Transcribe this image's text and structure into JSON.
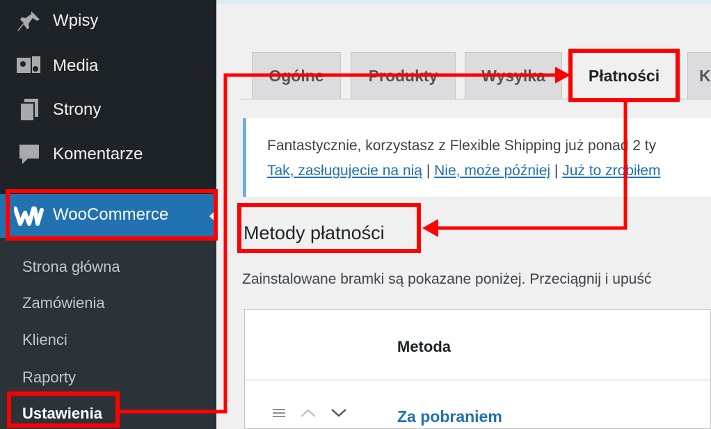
{
  "sidebar": {
    "items": [
      {
        "label": "Wpisy",
        "icon": "pin-icon"
      },
      {
        "label": "Media",
        "icon": "media-icon"
      },
      {
        "label": "Strony",
        "icon": "pages-icon"
      },
      {
        "label": "Komentarze",
        "icon": "comments-icon"
      }
    ],
    "woocommerce": {
      "label": "WooCommerce",
      "icon": "woocommerce-icon"
    },
    "submenu": [
      "Strona główna",
      "Zamówienia",
      "Klienci",
      "Raporty",
      "Ustawienia"
    ]
  },
  "tabs": [
    "Ogólne",
    "Produkty",
    "Wysyłka",
    "Płatności",
    "K"
  ],
  "notice": {
    "text": "Fantastycznie, korzystasz z Flexible Shipping już ponad 2 ty",
    "link_yes": "Tak, zasługujecie na nią",
    "link_later": "Nie, może później",
    "link_done": "Już to zrobiłem",
    "sep": "|"
  },
  "section": {
    "title": "Metody płatności",
    "description": "Zainstalowane bramki są pokazane poniżej. Przeciągnij i upuść"
  },
  "table": {
    "header_method": "Metoda",
    "rows": [
      {
        "method": "Za pobraniem"
      }
    ]
  },
  "colors": {
    "highlight": "#ff0000",
    "accent": "#2271b1",
    "sidebar": "#1d2327"
  }
}
